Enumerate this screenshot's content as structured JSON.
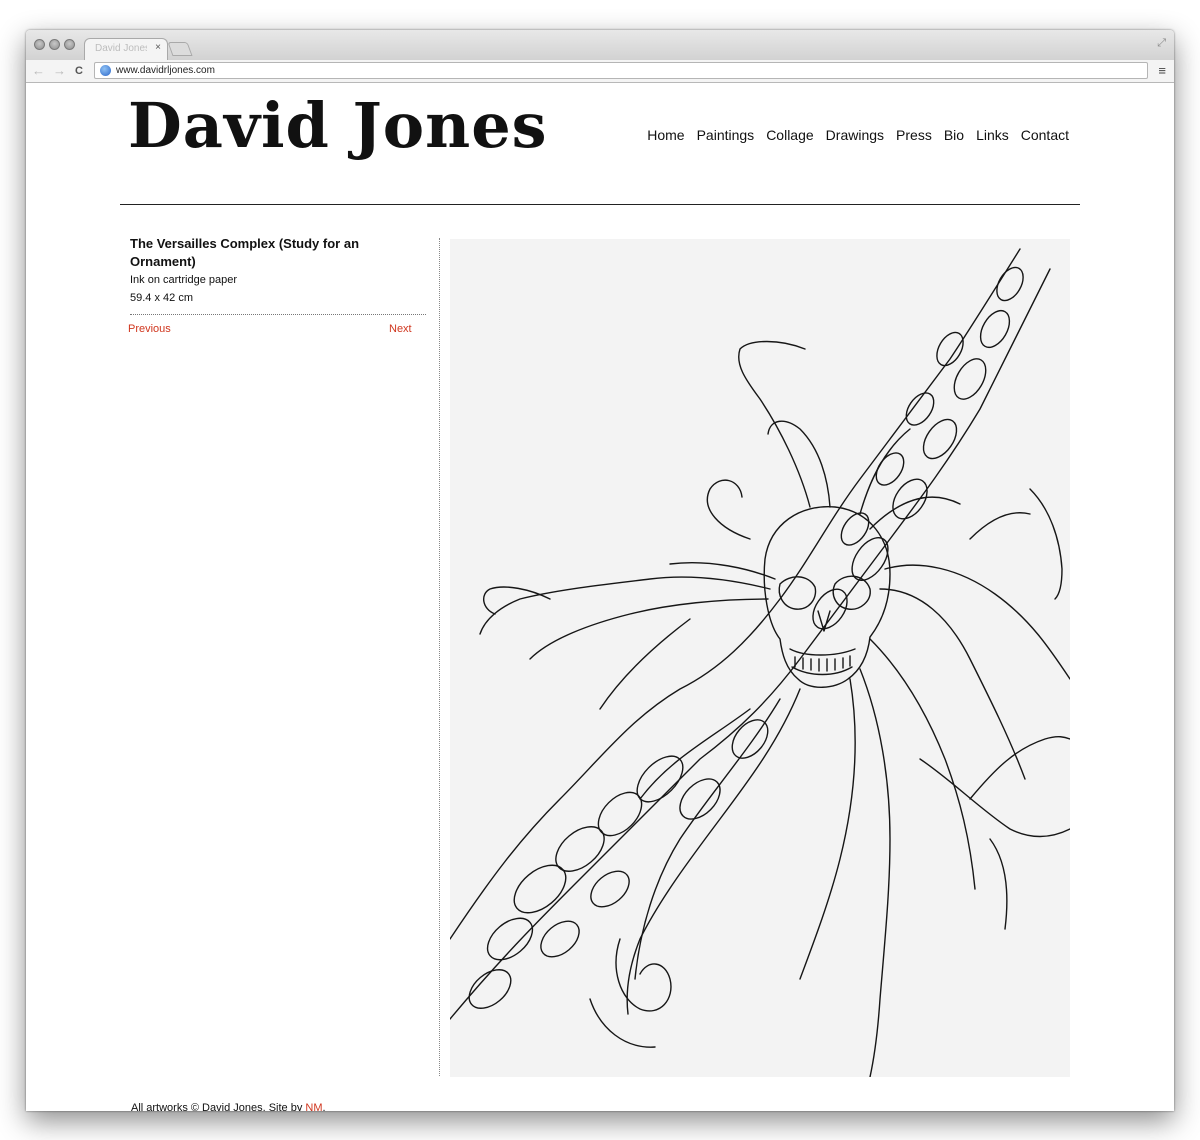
{
  "browser": {
    "tab_title": "David Jones",
    "tab_close": "×",
    "url": "www.davidrljones.com",
    "back_glyph": "←",
    "forward_glyph": "→",
    "reload_glyph": "C",
    "menu_glyph": "≡",
    "fullscreen_glyph": "⤢"
  },
  "site": {
    "title": "David Jones",
    "nav": [
      "Home",
      "Paintings",
      "Collage",
      "Drawings",
      "Press",
      "Bio",
      "Links",
      "Contact"
    ]
  },
  "artwork": {
    "title": "The Versailles Complex (Study for an Ornament)",
    "medium": "Ink on cartridge paper",
    "size": "59.4 x 42 cm",
    "image_icon": "skull-drawing-image"
  },
  "pager": {
    "previous": "Previous",
    "next": "Next"
  },
  "footer": {
    "text": "All artworks © David Jones. Site by ",
    "link": "NM",
    "suffix": "."
  },
  "colors": {
    "link_accent": "#d0361e",
    "text": "#111111",
    "paper": "#f3f3f3"
  }
}
